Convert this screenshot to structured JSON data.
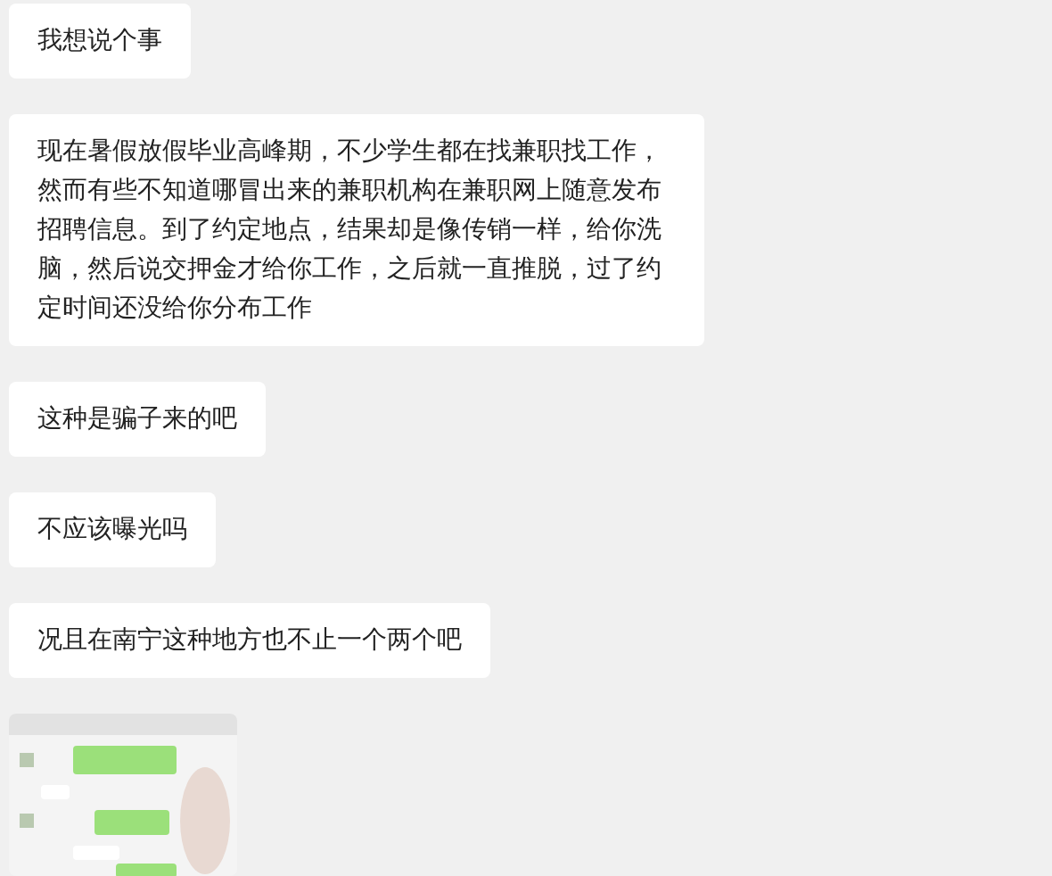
{
  "messages": [
    {
      "kind": "text",
      "text": "我想说个事"
    },
    {
      "kind": "text",
      "text": "现在暑假放假毕业高峰期，不少学生都在找兼职找工作，然而有些不知道哪冒出来的兼职机构在兼职网上随意发布招聘信息。到了约定地点，结果却是像传销一样，给你洗脑，然后说交押金才给你工作，之后就一直推脱，过了约定时间还没给你分布工作"
    },
    {
      "kind": "text",
      "text": "这种是骗子来的吧"
    },
    {
      "kind": "text",
      "text": "不应该曝光吗"
    },
    {
      "kind": "text",
      "text": "况且在南宁这种地方也不止一个两个吧"
    },
    {
      "kind": "picture"
    }
  ]
}
